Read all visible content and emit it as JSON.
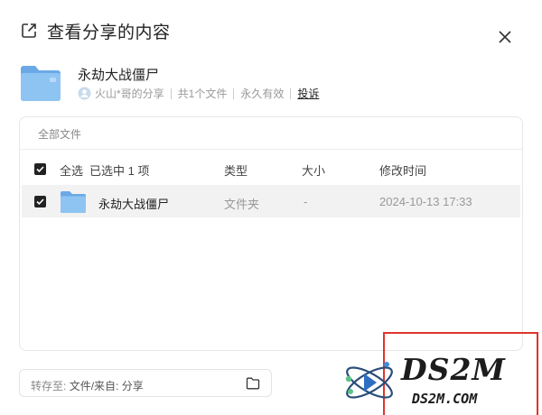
{
  "dialog": {
    "title": "查看分享的内容",
    "title_icon": "share-external-icon",
    "close_icon": "close-icon"
  },
  "share": {
    "name": "永劫大战僵尸",
    "owner": "火山*哥的分享",
    "count": "共1个文件",
    "validity": "永久有效",
    "report": "投诉"
  },
  "panel": {
    "breadcrumb": "全部文件",
    "select_all": "全选",
    "selected_count": "已选中 1 项",
    "columns": {
      "type": "类型",
      "size": "大小",
      "time": "修改时间"
    }
  },
  "files": [
    {
      "name": "永劫大战僵尸",
      "type": "文件夹",
      "size": "-",
      "time": "2024-10-13 17:33",
      "checked": true
    }
  ],
  "save": {
    "key": "转存至:",
    "value": "文件/来自: 分享"
  },
  "watermark": {
    "brand": "DS2M",
    "url": "DS2M.COM"
  },
  "colors": {
    "folder": "#7fb8ec",
    "highlight_red": "#e0342c",
    "row_bg": "#f2f2f2"
  }
}
